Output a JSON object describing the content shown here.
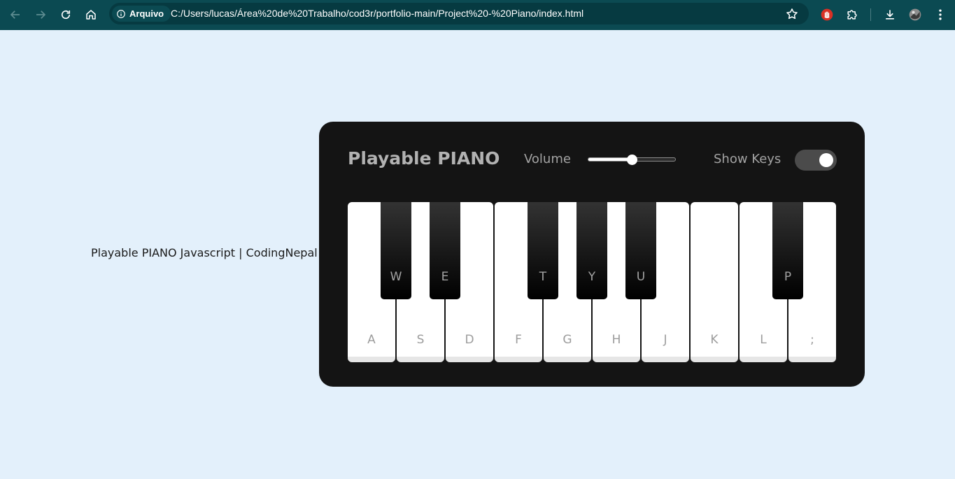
{
  "browser": {
    "site_label": "Arquivo",
    "url": "C:/Users/lucas/Área%20de%20Trabalho/cod3r/portfolio-main/Project%20-%20Piano/index.html",
    "icons": {
      "back": "arrow-left-icon",
      "forward": "arrow-right-icon",
      "reload": "reload-icon",
      "home": "home-icon",
      "info": "info-icon",
      "bookmark": "star-icon",
      "extension_red": "stop-hand-icon",
      "extensions": "puzzle-icon",
      "downloads": "download-icon",
      "profile": "avatar-icon",
      "menu": "kebab-menu-icon"
    },
    "colors": {
      "toolbar": "#0b4a52",
      "omnibox": "#063a41"
    }
  },
  "page": {
    "side_text": "Playable PIANO Javascript | CodingNepal",
    "background": "#e3f0fb"
  },
  "piano": {
    "title": "Playable PIANO",
    "volume_label": "Volume",
    "volume_value": 0.5,
    "show_keys_label": "Show Keys",
    "show_keys_on": true,
    "white_keys": [
      "A",
      "S",
      "D",
      "F",
      "G",
      "H",
      "J",
      "K",
      "L",
      ";"
    ],
    "black_keys": [
      "W",
      "E",
      "T",
      "Y",
      "U",
      "P"
    ]
  }
}
